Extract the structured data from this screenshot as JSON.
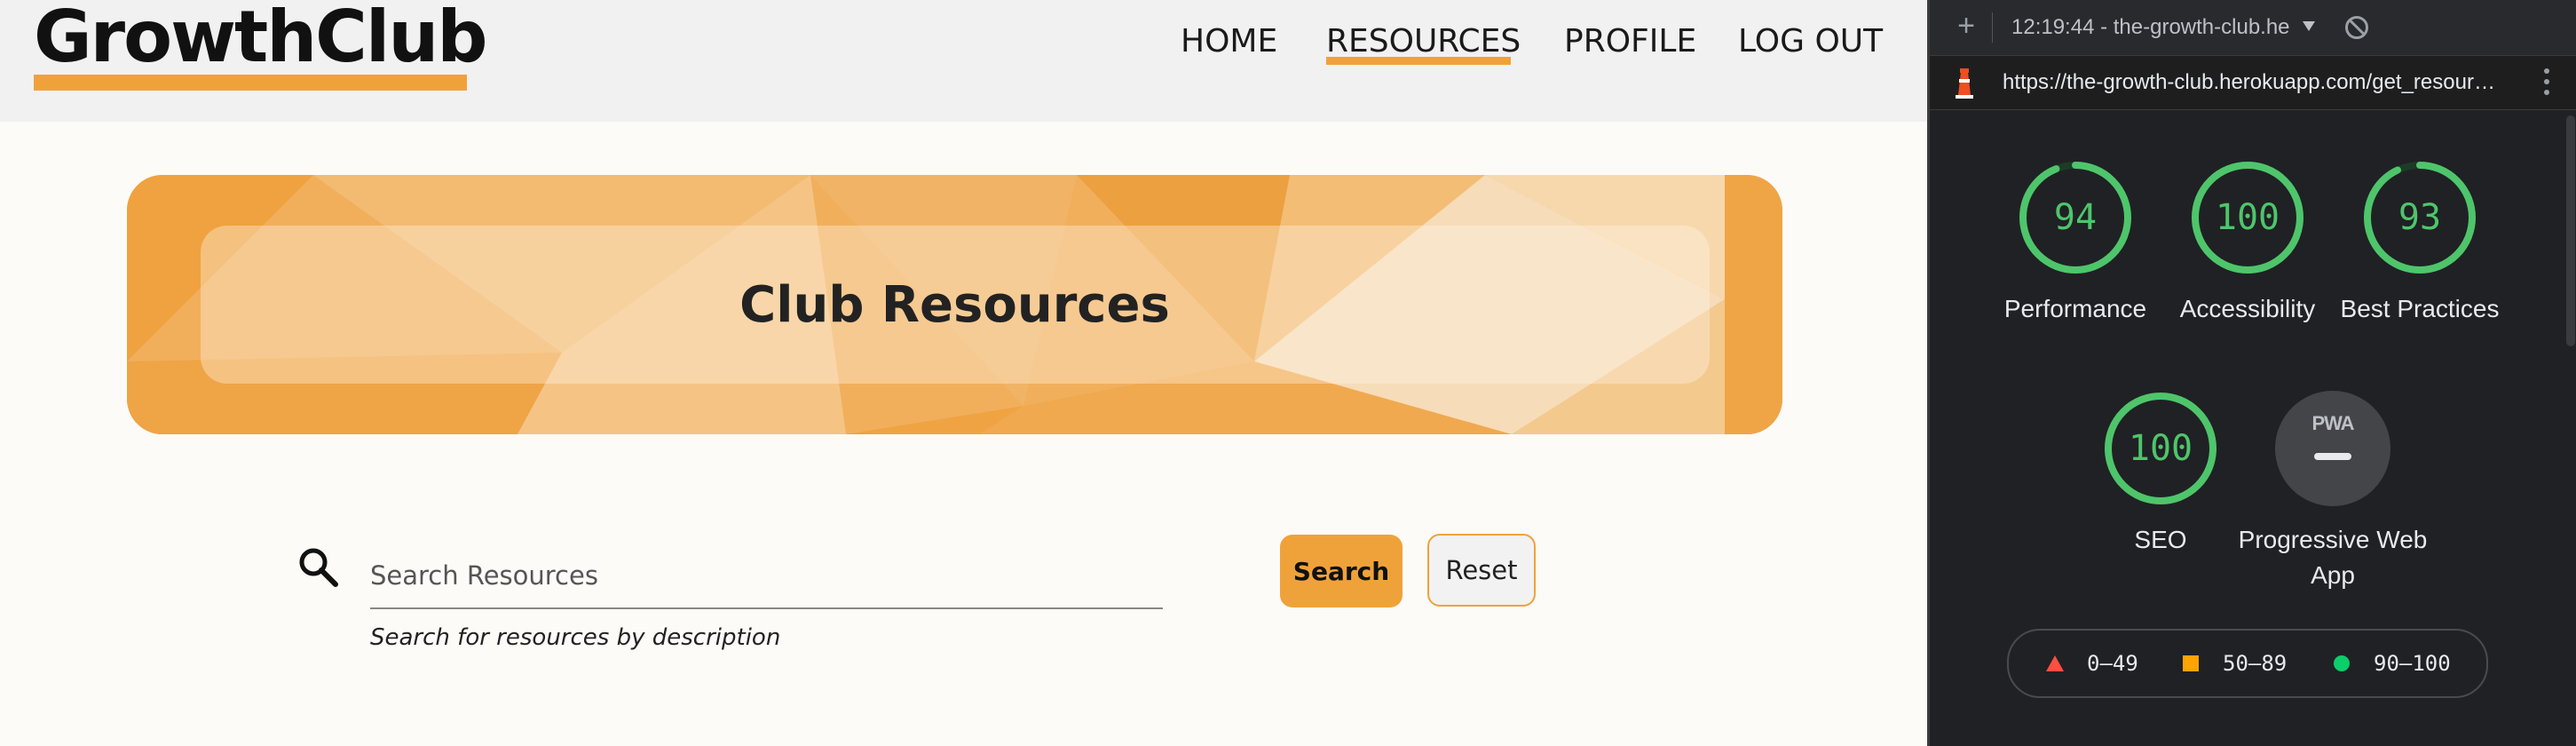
{
  "site": {
    "logo": "GrowthClub",
    "nav": [
      "HOME",
      "RESOURCES",
      "PROFILE",
      "LOG OUT"
    ],
    "active_nav": "RESOURCES",
    "banner_title": "Club Resources",
    "search": {
      "placeholder": "Search Resources",
      "helper": "Search for resources by description",
      "search_label": "Search",
      "reset_label": "Reset"
    },
    "accent_color": "#f0a23a"
  },
  "devtools": {
    "report_select": "12:19:44 - the-growth-club.he",
    "url": "https://the-growth-club.herokuapp.com/get_resour…",
    "scores": [
      {
        "label": "Performance",
        "value": "94",
        "fraction": 0.94
      },
      {
        "label": "Accessibility",
        "value": "100",
        "fraction": 1.0
      },
      {
        "label": "Best Practices",
        "value": "93",
        "fraction": 0.93
      },
      {
        "label": "SEO",
        "value": "100",
        "fraction": 1.0
      }
    ],
    "pwa": {
      "badge": "PWA",
      "label": "Progressive Web App"
    },
    "legend": [
      "0–49",
      "50–89",
      "90–100"
    ],
    "colors": {
      "pass": "#0cce6b",
      "average": "#ffa400",
      "fail": "#ff4e42"
    }
  }
}
